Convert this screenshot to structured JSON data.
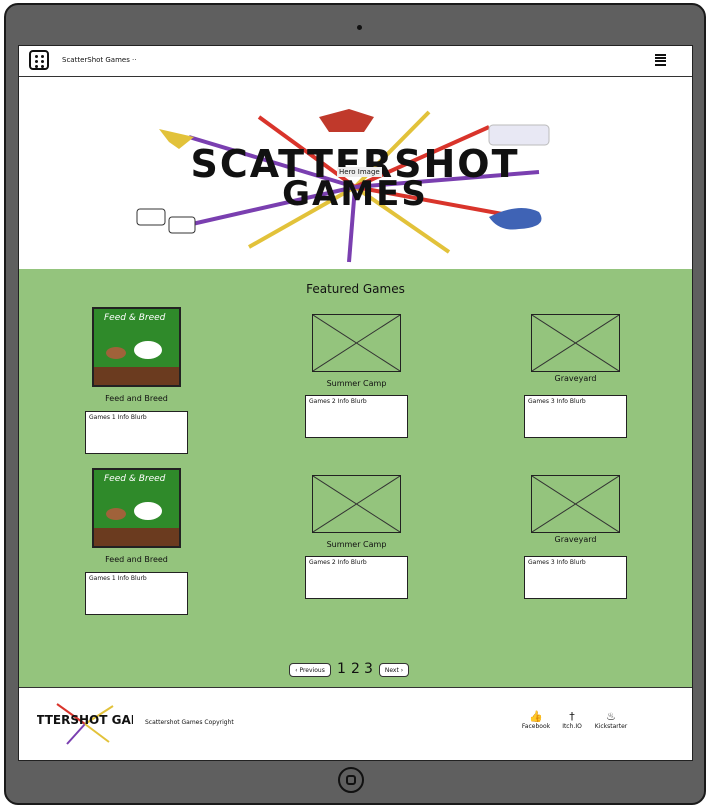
{
  "navbar": {
    "brand": "ScatterShot Games",
    "dots": "..",
    "logo_icon": "dice-icon",
    "menu_icon": "hamburger-menu-icon"
  },
  "hero": {
    "label": "Hero Image",
    "logo_text": "SCATTERSHOT GAMES"
  },
  "featured": {
    "title": "Featured Games",
    "rows": [
      [
        {
          "name": "Feed and Breed",
          "blurb": "Games 1 Info Blurb",
          "image": "feed-and-breed-cover"
        },
        {
          "name": "Summer Camp",
          "blurb": "Games 2 Info Blurb",
          "image": "placeholder"
        },
        {
          "name": "Graveyard",
          "blurb": "Games 3 Info Blurb",
          "image": "placeholder"
        }
      ],
      [
        {
          "name": "Feed and Breed",
          "blurb": "Games 1 Info Blurb",
          "image": "feed-and-breed-cover"
        },
        {
          "name": "Summer Camp",
          "blurb": "Games 2 Info Blurb",
          "image": "placeholder"
        },
        {
          "name": "Graveyard",
          "blurb": "Games 3 Info Blurb",
          "image": "placeholder"
        }
      ]
    ],
    "cover_title": "Feed & Breed"
  },
  "pagination": {
    "previous": "‹ Previous",
    "pages": [
      "1",
      "2",
      "3"
    ],
    "next": "Next ›"
  },
  "footer": {
    "logo_text": "SCATTERSHOT GAMES",
    "copyright": "Scattershot Games Copyright",
    "links": [
      {
        "label": "Facebook",
        "icon": "thumbs-up-icon",
        "glyph": "👍"
      },
      {
        "label": "Itch.IO",
        "icon": "sword-icon",
        "glyph": "†"
      },
      {
        "label": "Kickstarter",
        "icon": "flame-icon",
        "glyph": "♨"
      }
    ]
  },
  "colors": {
    "featured_bg": "#94c47d",
    "device_frame": "#5f5f5f"
  }
}
